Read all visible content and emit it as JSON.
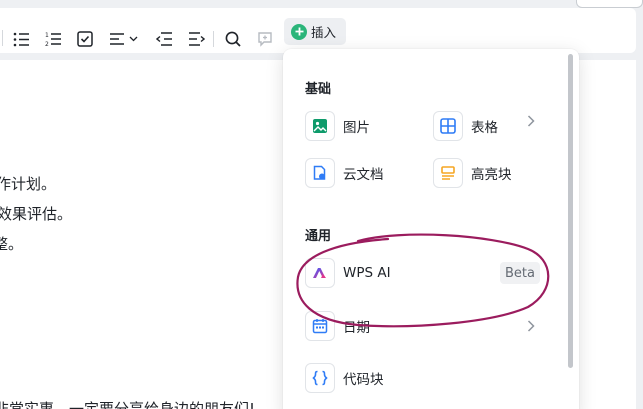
{
  "toolbar": {
    "icons": [
      "bullet-list-icon",
      "numbered-list-icon",
      "checkbox-icon",
      "align-icon",
      "chevron-down-icon",
      "outdent-icon",
      "indent-icon",
      "search-icon",
      "comment-icon"
    ],
    "insert_label": "插入",
    "insert_icon_color": "#2bb57a"
  },
  "editor": {
    "lines": [
      "作计划。",
      "效果评估。",
      "整。",
      "非常实惠，一定要分享给身边的朋友们!"
    ]
  },
  "insert_menu": {
    "sections": {
      "basic_title": "基础",
      "general_title": "通用"
    },
    "items": {
      "image": "图片",
      "table": "表格",
      "cloud_doc": "云文档",
      "highlight_block": "高亮块",
      "wps_ai": "WPS AI",
      "wps_ai_badge": "Beta",
      "date": "日期",
      "code_block": "代码块"
    }
  },
  "colors": {
    "accent_green": "#2bb57a",
    "icon_blue": "#2f7cf6",
    "icon_orange": "#f5a623",
    "annotation": "#9b1c5e"
  }
}
